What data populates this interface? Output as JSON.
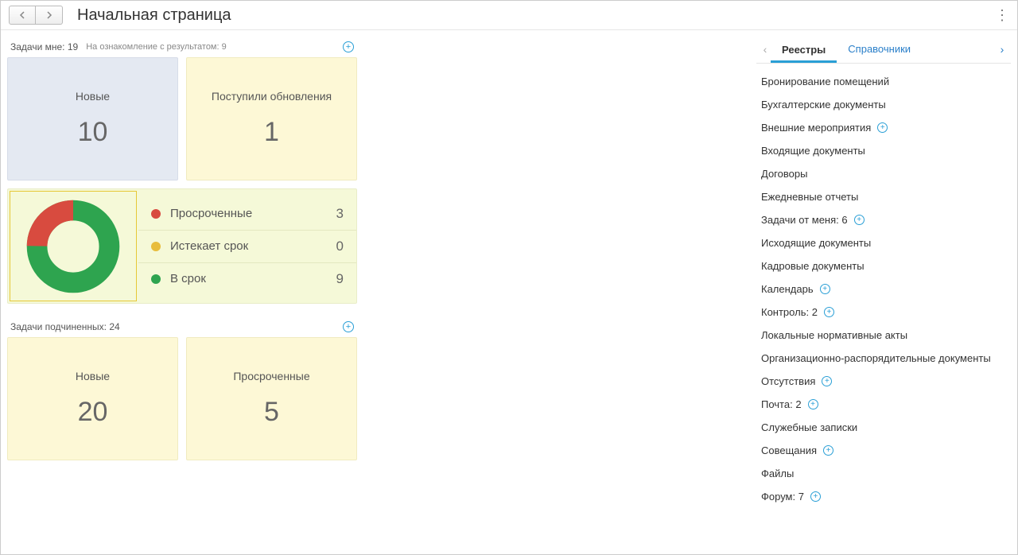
{
  "header": {
    "title": "Начальная страница"
  },
  "tasks_to_me": {
    "title": "Задачи мне: 19",
    "subtitle": "На ознакомление с результатом: 9",
    "cards": [
      {
        "label": "Новые",
        "value": "10"
      },
      {
        "label": "Поступили обновления",
        "value": "1"
      }
    ]
  },
  "chart_data": {
    "type": "pie",
    "title": "",
    "series": [
      {
        "name": "Просроченные",
        "value": 3,
        "color": "#d84b3f"
      },
      {
        "name": "Истекает срок",
        "value": 0,
        "color": "#e8bd3c"
      },
      {
        "name": "В срок",
        "value": 9,
        "color": "#2ea44f"
      }
    ]
  },
  "legend": {
    "rows": [
      {
        "label": "Просроченные",
        "value": "3"
      },
      {
        "label": "Истекает срок",
        "value": "0"
      },
      {
        "label": "В срок",
        "value": "9"
      }
    ]
  },
  "sub_tasks": {
    "title": "Задачи подчиненных: 24",
    "cards": [
      {
        "label": "Новые",
        "value": "20"
      },
      {
        "label": "Просроченные",
        "value": "5"
      }
    ]
  },
  "right": {
    "tabs": {
      "active": "Реестры",
      "inactive": "Справочники"
    },
    "items": [
      {
        "label": "Бронирование помещений",
        "plus": false
      },
      {
        "label": "Бухгалтерские документы",
        "plus": false
      },
      {
        "label": "Внешние мероприятия",
        "plus": true
      },
      {
        "label": "Входящие документы",
        "plus": false
      },
      {
        "label": "Договоры",
        "plus": false
      },
      {
        "label": "Ежедневные отчеты",
        "plus": false
      },
      {
        "label": "Задачи от меня: 6",
        "plus": true
      },
      {
        "label": "Исходящие документы",
        "plus": false
      },
      {
        "label": "Кадровые документы",
        "plus": false
      },
      {
        "label": "Календарь",
        "plus": true
      },
      {
        "label": "Контроль: 2",
        "plus": true
      },
      {
        "label": "Локальные нормативные акты",
        "plus": false
      },
      {
        "label": "Организационно-распорядительные документы",
        "plus": false
      },
      {
        "label": "Отсутствия",
        "plus": true
      },
      {
        "label": "Почта: 2",
        "plus": true
      },
      {
        "label": "Служебные записки",
        "plus": false
      },
      {
        "label": "Совещания",
        "plus": true
      },
      {
        "label": "Файлы",
        "plus": false
      },
      {
        "label": "Форум: 7",
        "plus": true
      }
    ]
  }
}
